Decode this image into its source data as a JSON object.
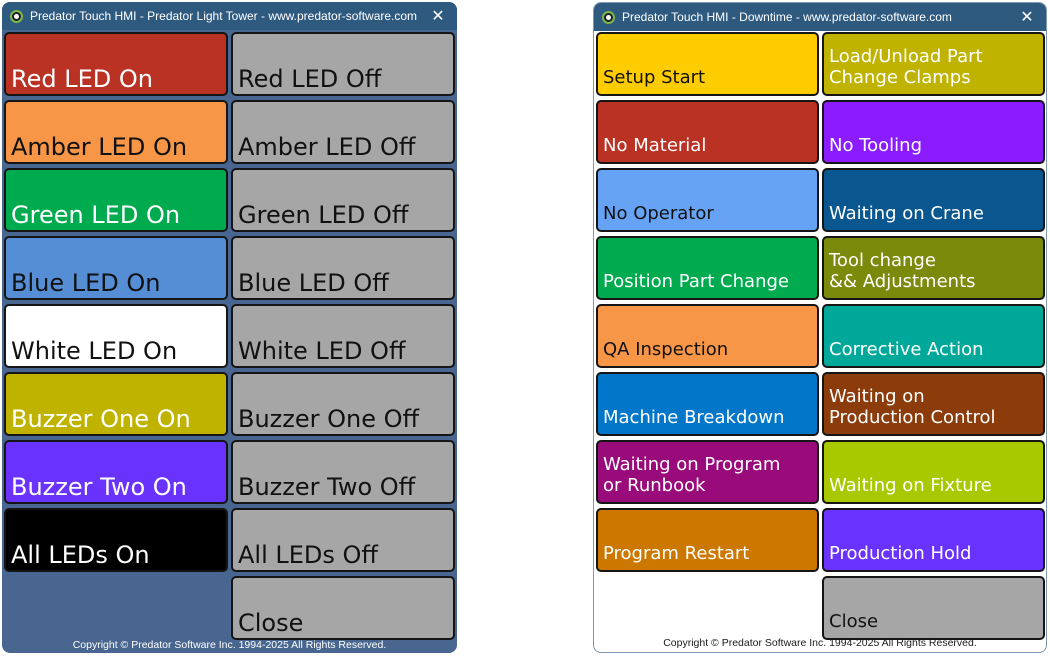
{
  "light_tower": {
    "title": "Predator Touch HMI - Predator Light Tower - www.predator-software.com",
    "close_glyph": "✕",
    "footer": "Copyright © Predator Software Inc. 1994-2025 All Rights Reserved.",
    "buttons": [
      {
        "label": "Red LED On",
        "bg": "#b93224",
        "fg": "#ffffff"
      },
      {
        "label": "Red LED Off",
        "bg": "#a6a6a6",
        "fg": "#111111"
      },
      {
        "label": "Amber LED On",
        "bg": "#f79646",
        "fg": "#111111"
      },
      {
        "label": "Amber LED Off",
        "bg": "#a6a6a6",
        "fg": "#111111"
      },
      {
        "label": "Green LED On",
        "bg": "#00aa4f",
        "fg": "#ffffff"
      },
      {
        "label": "Green LED Off",
        "bg": "#a6a6a6",
        "fg": "#111111"
      },
      {
        "label": "Blue LED On",
        "bg": "#558ed5",
        "fg": "#111111"
      },
      {
        "label": "Blue LED Off",
        "bg": "#a6a6a6",
        "fg": "#111111"
      },
      {
        "label": "White LED On",
        "bg": "#ffffff",
        "fg": "#111111"
      },
      {
        "label": "White LED Off",
        "bg": "#a6a6a6",
        "fg": "#111111"
      },
      {
        "label": "Buzzer One On",
        "bg": "#bfb300",
        "fg": "#ffffff"
      },
      {
        "label": "Buzzer One Off",
        "bg": "#a6a6a6",
        "fg": "#111111"
      },
      {
        "label": "Buzzer Two On",
        "bg": "#6a32ff",
        "fg": "#ffffff"
      },
      {
        "label": "Buzzer Two Off",
        "bg": "#a6a6a6",
        "fg": "#111111"
      },
      {
        "label": "All LEDs On",
        "bg": "#000000",
        "fg": "#ffffff"
      },
      {
        "label": "All LEDs Off",
        "bg": "#a6a6a6",
        "fg": "#111111"
      },
      {
        "label": "",
        "bg": "transparent",
        "fg": "#111111",
        "spacer": true
      },
      {
        "label": "Close",
        "bg": "#a6a6a6",
        "fg": "#111111"
      }
    ]
  },
  "downtime": {
    "title": "Predator Touch HMI - Downtime - www.predator-software.com",
    "close_glyph": "✕",
    "footer": "Copyright © Predator Software Inc. 1994-2025 All Rights Reserved.",
    "buttons": [
      {
        "label": "Setup Start",
        "bg": "#ffcc00",
        "fg": "#111111"
      },
      {
        "label": "Load/Unload Part\nChange Clamps",
        "bg": "#bfb300",
        "fg": "#ffffff"
      },
      {
        "label": "No Material",
        "bg": "#b93224",
        "fg": "#ffffff"
      },
      {
        "label": "No Tooling",
        "bg": "#8a1cff",
        "fg": "#ffffff"
      },
      {
        "label": "No Operator",
        "bg": "#66a3f5",
        "fg": "#111111"
      },
      {
        "label": "Waiting on Crane",
        "bg": "#0a568f",
        "fg": "#ffffff"
      },
      {
        "label": "Position Part Change",
        "bg": "#00aa4f",
        "fg": "#ffffff"
      },
      {
        "label": "Tool change\n&& Adjustments",
        "bg": "#7a8a0a",
        "fg": "#ffffff"
      },
      {
        "label": "QA Inspection",
        "bg": "#f79646",
        "fg": "#111111"
      },
      {
        "label": "Corrective Action",
        "bg": "#00a89a",
        "fg": "#ffffff"
      },
      {
        "label": "Machine Breakdown",
        "bg": "#0277c9",
        "fg": "#ffffff"
      },
      {
        "label": "Waiting on\nProduction Control",
        "bg": "#8b3c0a",
        "fg": "#ffffff"
      },
      {
        "label": "Waiting on Program\nor Runbook",
        "bg": "#990a7a",
        "fg": "#ffffff"
      },
      {
        "label": "Waiting on Fixture",
        "bg": "#a8c800",
        "fg": "#ffffff"
      },
      {
        "label": "Program Restart",
        "bg": "#cc7700",
        "fg": "#ffffff"
      },
      {
        "label": "Production Hold",
        "bg": "#6a32ff",
        "fg": "#ffffff"
      },
      {
        "label": "",
        "bg": "transparent",
        "fg": "#111111",
        "spacer": true
      },
      {
        "label": "Close",
        "bg": "#a6a6a6",
        "fg": "#111111"
      }
    ]
  }
}
